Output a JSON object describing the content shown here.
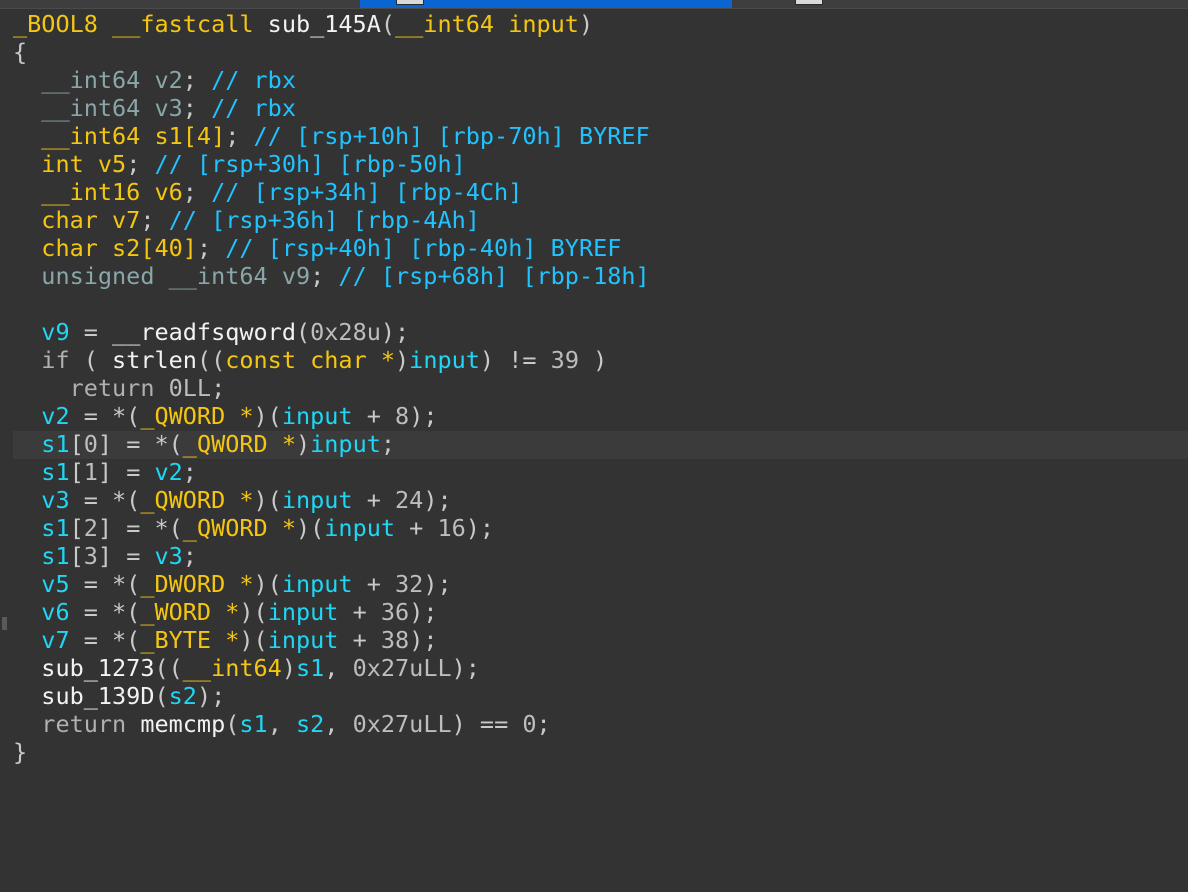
{
  "theme": {
    "background": "#333333",
    "current_line": "#3b3b3b",
    "tab_active": "#0a64d2",
    "token_colors": {
      "t": "#f5c611",
      "v": "#1fd6f5",
      "f": "#f2f2f2",
      "p": "#c9c9c9",
      "n": "#bdbdbd",
      "k": "#b0b0b0",
      "c": "#21c3ff",
      "s": "#8aa6a8"
    }
  },
  "editor": {
    "lines": [
      [
        [
          "t",
          "_BOOL8 __fastcall "
        ],
        [
          "f",
          "sub_145A"
        ],
        [
          "p",
          "("
        ],
        [
          "t",
          "__int64 input"
        ],
        [
          "p",
          ")"
        ]
      ],
      [
        [
          "p",
          "{"
        ]
      ],
      [
        [
          "s",
          "  __int64 v2"
        ],
        [
          "p",
          "; "
        ],
        [
          "c",
          "// rbx"
        ]
      ],
      [
        [
          "s",
          "  __int64 v3"
        ],
        [
          "p",
          "; "
        ],
        [
          "c",
          "// rbx"
        ]
      ],
      [
        [
          "t",
          "  __int64 s1[4]"
        ],
        [
          "p",
          "; "
        ],
        [
          "c",
          "// [rsp+10h] [rbp-70h] BYREF"
        ]
      ],
      [
        [
          "t",
          "  int v5"
        ],
        [
          "p",
          "; "
        ],
        [
          "c",
          "// [rsp+30h] [rbp-50h]"
        ]
      ],
      [
        [
          "t",
          "  __int16 v6"
        ],
        [
          "p",
          "; "
        ],
        [
          "c",
          "// [rsp+34h] [rbp-4Ch]"
        ]
      ],
      [
        [
          "t",
          "  char v7"
        ],
        [
          "p",
          "; "
        ],
        [
          "c",
          "// [rsp+36h] [rbp-4Ah]"
        ]
      ],
      [
        [
          "t",
          "  char s2[40]"
        ],
        [
          "p",
          "; "
        ],
        [
          "c",
          "// [rsp+40h] [rbp-40h] BYREF"
        ]
      ],
      [
        [
          "s",
          "  unsigned __int64 v9"
        ],
        [
          "p",
          "; "
        ],
        [
          "c",
          "// [rsp+68h] [rbp-18h]"
        ]
      ],
      [
        [
          "p",
          ""
        ]
      ],
      [
        [
          "v",
          "  v9"
        ],
        [
          "p",
          " = "
        ],
        [
          "f",
          "__readfsqword"
        ],
        [
          "p",
          "("
        ],
        [
          "n",
          "0x28u"
        ],
        [
          "p",
          ");"
        ]
      ],
      [
        [
          "k",
          "  if"
        ],
        [
          "p",
          " ( "
        ],
        [
          "f",
          "strlen"
        ],
        [
          "p",
          "(("
        ],
        [
          "t",
          "const char *"
        ],
        [
          "p",
          ")"
        ],
        [
          "v",
          "input"
        ],
        [
          "p",
          ") != "
        ],
        [
          "n",
          "39"
        ],
        [
          "p",
          " )"
        ]
      ],
      [
        [
          "k",
          "    return"
        ],
        [
          "p",
          " "
        ],
        [
          "n",
          "0LL"
        ],
        [
          "p",
          ";"
        ]
      ],
      [
        [
          "v",
          "  v2"
        ],
        [
          "p",
          " = *("
        ],
        [
          "t",
          "_QWORD *"
        ],
        [
          "p",
          ")("
        ],
        [
          "v",
          "input"
        ],
        [
          "p",
          " + "
        ],
        [
          "n",
          "8"
        ],
        [
          "p",
          ");"
        ]
      ],
      [
        [
          "v",
          "  s1"
        ],
        [
          "p",
          "["
        ],
        [
          "n",
          "0"
        ],
        [
          "p",
          "] = *("
        ],
        [
          "t",
          "_QWORD *"
        ],
        [
          "p",
          ")"
        ],
        [
          "v",
          "input"
        ],
        [
          "p",
          ";"
        ]
      ],
      [
        [
          "v",
          "  s1"
        ],
        [
          "p",
          "["
        ],
        [
          "n",
          "1"
        ],
        [
          "p",
          "] = "
        ],
        [
          "v",
          "v2"
        ],
        [
          "p",
          ";"
        ]
      ],
      [
        [
          "v",
          "  v3"
        ],
        [
          "p",
          " = *("
        ],
        [
          "t",
          "_QWORD *"
        ],
        [
          "p",
          ")("
        ],
        [
          "v",
          "input"
        ],
        [
          "p",
          " + "
        ],
        [
          "n",
          "24"
        ],
        [
          "p",
          ");"
        ]
      ],
      [
        [
          "v",
          "  s1"
        ],
        [
          "p",
          "["
        ],
        [
          "n",
          "2"
        ],
        [
          "p",
          "] = *("
        ],
        [
          "t",
          "_QWORD *"
        ],
        [
          "p",
          ")("
        ],
        [
          "v",
          "input"
        ],
        [
          "p",
          " + "
        ],
        [
          "n",
          "16"
        ],
        [
          "p",
          ");"
        ]
      ],
      [
        [
          "v",
          "  s1"
        ],
        [
          "p",
          "["
        ],
        [
          "n",
          "3"
        ],
        [
          "p",
          "] = "
        ],
        [
          "v",
          "v3"
        ],
        [
          "p",
          ";"
        ]
      ],
      [
        [
          "v",
          "  v5"
        ],
        [
          "p",
          " = *("
        ],
        [
          "t",
          "_DWORD *"
        ],
        [
          "p",
          ")("
        ],
        [
          "v",
          "input"
        ],
        [
          "p",
          " + "
        ],
        [
          "n",
          "32"
        ],
        [
          "p",
          ");"
        ]
      ],
      [
        [
          "v",
          "  v6"
        ],
        [
          "p",
          " = *("
        ],
        [
          "t",
          "_WORD *"
        ],
        [
          "p",
          ")("
        ],
        [
          "v",
          "input"
        ],
        [
          "p",
          " + "
        ],
        [
          "n",
          "36"
        ],
        [
          "p",
          ");"
        ]
      ],
      [
        [
          "v",
          "  v7"
        ],
        [
          "p",
          " = *("
        ],
        [
          "t",
          "_BYTE *"
        ],
        [
          "p",
          ")("
        ],
        [
          "v",
          "input"
        ],
        [
          "p",
          " + "
        ],
        [
          "n",
          "38"
        ],
        [
          "p",
          ");"
        ]
      ],
      [
        [
          "f",
          "  sub_1273"
        ],
        [
          "p",
          "(("
        ],
        [
          "t",
          "__int64"
        ],
        [
          "p",
          ")"
        ],
        [
          "v",
          "s1"
        ],
        [
          "p",
          ", "
        ],
        [
          "n",
          "0x27uLL"
        ],
        [
          "p",
          ");"
        ]
      ],
      [
        [
          "f",
          "  sub_139D"
        ],
        [
          "p",
          "("
        ],
        [
          "v",
          "s2"
        ],
        [
          "p",
          ");"
        ]
      ],
      [
        [
          "k",
          "  return"
        ],
        [
          "p",
          " "
        ],
        [
          "f",
          "memcmp"
        ],
        [
          "p",
          "("
        ],
        [
          "v",
          "s1"
        ],
        [
          "p",
          ", "
        ],
        [
          "v",
          "s2"
        ],
        [
          "p",
          ", "
        ],
        [
          "n",
          "0x27uLL"
        ],
        [
          "p",
          ") == "
        ],
        [
          "n",
          "0"
        ],
        [
          "p",
          ";"
        ]
      ],
      [
        [
          "p",
          "}"
        ]
      ]
    ]
  }
}
